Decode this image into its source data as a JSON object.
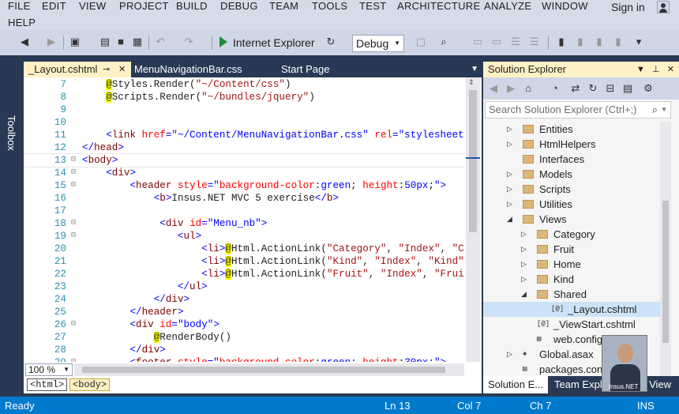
{
  "menu": {
    "items": [
      "FILE",
      "EDIT",
      "VIEW",
      "PROJECT",
      "BUILD",
      "DEBUG",
      "TEAM",
      "TOOLS",
      "TEST",
      "ARCHITECTURE",
      "ANALYZE",
      "WINDOW"
    ],
    "help": "HELP",
    "sign_in": "Sign in"
  },
  "toolbar": {
    "run_target": "Internet Explorer",
    "config": "Debug"
  },
  "toolbox_label": "Toolbox",
  "editor": {
    "tabs": [
      {
        "label": "_Layout.cshtml",
        "active": true
      },
      {
        "label": "MenuNavigationBar.css",
        "active": false
      },
      {
        "label": "Start Page",
        "active": false
      }
    ],
    "lines": [
      {
        "n": "7",
        "fold": "",
        "html": "    <span class=\"rz\">@</span>Styles.Render(<span class=\"st\">\"~/Content/css\"</span>)"
      },
      {
        "n": "8",
        "fold": "",
        "html": "    <span class=\"rz\">@</span>Scripts.Render(<span class=\"st\">\"~/bundles/jquery\"</span>)"
      },
      {
        "n": "9",
        "fold": "",
        "html": ""
      },
      {
        "n": "10",
        "fold": "",
        "html": ""
      },
      {
        "n": "11",
        "fold": "",
        "html": "    <span class=\"av\">&lt;</span><span class=\"kw\">link</span> <span class=\"at\">href</span><span class=\"av\">=\"~/Content/MenuNavigationBar.css\"</span> <span class=\"at\">rel</span><span class=\"av\">=\"stylesheet\"</span> <span class=\"av\">/&gt;</span>"
      },
      {
        "n": "12",
        "fold": "",
        "html": "<span class=\"av\">&lt;/</span><span class=\"kw\">head</span><span class=\"av\">&gt;</span>"
      },
      {
        "n": "13",
        "fold": "⊟",
        "html": "<span class=\"av\">&lt;</span><span class=\"kw\">body</span><span class=\"av\">&gt;</span>",
        "current": true
      },
      {
        "n": "14",
        "fold": "⊟",
        "html": "    <span class=\"av\">&lt;</span><span class=\"kw\">div</span><span class=\"av\">&gt;</span>"
      },
      {
        "n": "15",
        "fold": "⊟",
        "html": "        <span class=\"av\">&lt;</span><span class=\"kw\">header</span> <span class=\"at\">style</span><span class=\"av\">=\"</span><span class=\"at\">background-color</span>:<span class=\"av\">green</span>; <span class=\"at\">height</span>:<span class=\"av\">50px</span>;<span class=\"av\">\"&gt;</span>"
      },
      {
        "n": "16",
        "fold": "",
        "html": "            <span class=\"av\">&lt;</span><span class=\"kw\">b</span><span class=\"av\">&gt;</span>Insus.NET MVC 5 exercise<span class=\"av\">&lt;/</span><span class=\"kw\">b</span><span class=\"av\">&gt;</span>"
      },
      {
        "n": "17",
        "fold": "",
        "html": ""
      },
      {
        "n": "18",
        "fold": "⊟",
        "html": "             <span class=\"av\">&lt;</span><span class=\"kw\">div</span> <span class=\"at\">id</span><span class=\"av\">=\"Menu_nb\"</span><span class=\"av\">&gt;</span>"
      },
      {
        "n": "19",
        "fold": "⊟",
        "html": "                <span class=\"av\">&lt;</span><span class=\"kw\">ul</span><span class=\"av\">&gt;</span>"
      },
      {
        "n": "20",
        "fold": "",
        "html": "                    <span class=\"av\">&lt;</span><span class=\"kw\">li</span><span class=\"av\">&gt;</span><span class=\"rz\">@</span>Html.ActionLink(<span class=\"st\">\"Category\"</span>, <span class=\"st\">\"Index\"</span>, <span class=\"st\">\"Catego</span>"
      },
      {
        "n": "21",
        "fold": "",
        "html": "                    <span class=\"av\">&lt;</span><span class=\"kw\">li</span><span class=\"av\">&gt;</span><span class=\"rz\">@</span>Html.ActionLink(<span class=\"st\">\"Kind\"</span>, <span class=\"st\">\"Index\"</span>, <span class=\"st\">\"Kind\"</span>)<span class=\"av\">&lt;/</span><span class=\"kw\">li</span>"
      },
      {
        "n": "22",
        "fold": "",
        "html": "                    <span class=\"av\">&lt;</span><span class=\"kw\">li</span><span class=\"av\">&gt;</span><span class=\"rz\">@</span>Html.ActionLink(<span class=\"st\">\"Fruit\"</span>, <span class=\"st\">\"Index\"</span>, <span class=\"st\">\"Fruit\"</span>)<span class=\"av\">&lt;/</span>"
      },
      {
        "n": "23",
        "fold": "",
        "html": "                <span class=\"av\">&lt;/</span><span class=\"kw\">ul</span><span class=\"av\">&gt;</span>"
      },
      {
        "n": "24",
        "fold": "",
        "html": "            <span class=\"av\">&lt;/</span><span class=\"kw\">div</span><span class=\"av\">&gt;</span>"
      },
      {
        "n": "25",
        "fold": "",
        "html": "        <span class=\"av\">&lt;/</span><span class=\"kw\">header</span><span class=\"av\">&gt;</span>"
      },
      {
        "n": "26",
        "fold": "⊟",
        "html": "        <span class=\"av\">&lt;</span><span class=\"kw\">div</span> <span class=\"at\">id</span><span class=\"av\">=\"body\"</span><span class=\"av\">&gt;</span>"
      },
      {
        "n": "27",
        "fold": "",
        "html": "            <span class=\"rz\">@</span>RenderBody()"
      },
      {
        "n": "28",
        "fold": "",
        "html": "        <span class=\"av\">&lt;/</span><span class=\"kw\">div</span><span class=\"av\">&gt;</span>"
      },
      {
        "n": "29",
        "fold": "⊟",
        "html": "        <span class=\"av\">&lt;</span><span class=\"kw\">footer</span> <span class=\"at\">style</span><span class=\"av\">=\"</span><span class=\"at\">background-color</span>:<span class=\"av\">green</span>; <span class=\"at\">height</span>:<span class=\"av\">30px</span>;<span class=\"av\">\"&gt;</span>"
      }
    ],
    "zoom": "100 %",
    "breadcrumbs": [
      "<html>",
      "<body>"
    ]
  },
  "solution_explorer": {
    "title": "Solution Explorer",
    "search_placeholder": "Search Solution Explorer (Ctrl+;)",
    "tree": [
      {
        "label": "Entities",
        "type": "folder",
        "depth": 0,
        "arrow": "closed"
      },
      {
        "label": "HtmlHelpers",
        "type": "folder",
        "depth": 0,
        "arrow": "closed"
      },
      {
        "label": "Interfaces",
        "type": "folder",
        "depth": 0,
        "arrow": "none"
      },
      {
        "label": "Models",
        "type": "folder",
        "depth": 0,
        "arrow": "closed"
      },
      {
        "label": "Scripts",
        "type": "folder",
        "depth": 0,
        "arrow": "closed"
      },
      {
        "label": "Utilities",
        "type": "folder",
        "depth": 0,
        "arrow": "closed"
      },
      {
        "label": "Views",
        "type": "folder",
        "depth": 0,
        "arrow": "open"
      },
      {
        "label": "Category",
        "type": "folder",
        "depth": 1,
        "arrow": "closed"
      },
      {
        "label": "Fruit",
        "type": "folder",
        "depth": 1,
        "arrow": "closed"
      },
      {
        "label": "Home",
        "type": "folder",
        "depth": 1,
        "arrow": "closed"
      },
      {
        "label": "Kind",
        "type": "folder",
        "depth": 1,
        "arrow": "closed"
      },
      {
        "label": "Shared",
        "type": "folder",
        "depth": 1,
        "arrow": "open"
      },
      {
        "label": "_Layout.cshtml",
        "type": "razor",
        "depth": 2,
        "arrow": "none",
        "selected": true
      },
      {
        "label": "_ViewStart.cshtml",
        "type": "razor",
        "depth": 1,
        "arrow": "none"
      },
      {
        "label": "web.config",
        "type": "config",
        "depth": 1,
        "arrow": "none"
      },
      {
        "label": "Global.asax",
        "type": "asax",
        "depth": 0,
        "arrow": "closed"
      },
      {
        "label": "packages.config",
        "type": "config",
        "depth": 0,
        "arrow": "none"
      }
    ],
    "bottom_tabs": [
      {
        "label": "Solution E...",
        "active": true
      },
      {
        "label": "Team Expl...",
        "active": false
      },
      {
        "label": "Class View",
        "active": false
      }
    ],
    "watermark": "Insus.NET"
  },
  "status": {
    "ready": "Ready",
    "ln": "Ln 13",
    "col": "Col 7",
    "ch": "Ch 7",
    "mode": "INS"
  }
}
